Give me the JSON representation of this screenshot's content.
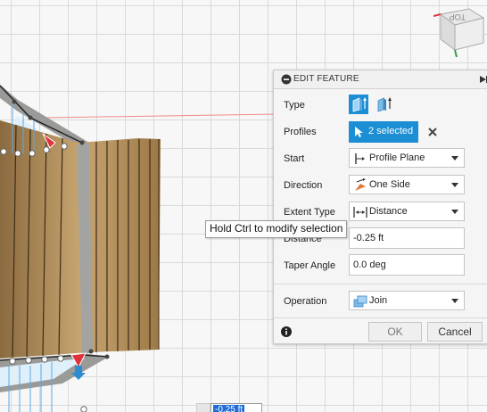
{
  "panel": {
    "title": "EDIT FEATURE",
    "type_label": "Type",
    "profiles_label": "Profiles",
    "profiles_value": "2 selected",
    "start_label": "Start",
    "start_value": "Profile Plane",
    "direction_label": "Direction",
    "direction_value": "One Side",
    "extent_label": "Extent Type",
    "extent_value": "Distance",
    "distance_label": "Distance",
    "distance_value": "-0.25 ft",
    "taper_label": "Taper Angle",
    "taper_value": "0.0 deg",
    "operation_label": "Operation",
    "operation_value": "Join",
    "ok_label": "OK",
    "cancel_label": "Cancel"
  },
  "tooltip": {
    "text": "Hold Ctrl to modify selection"
  },
  "viewcube": {
    "face_label": "TOP"
  },
  "canvas_input": {
    "value": "-0.25 ft"
  },
  "colors": {
    "accent": "#1b8ed4",
    "wood": "#b8925d",
    "selection_red": "#e0323a",
    "profile_blue": "#5aa9e6"
  }
}
